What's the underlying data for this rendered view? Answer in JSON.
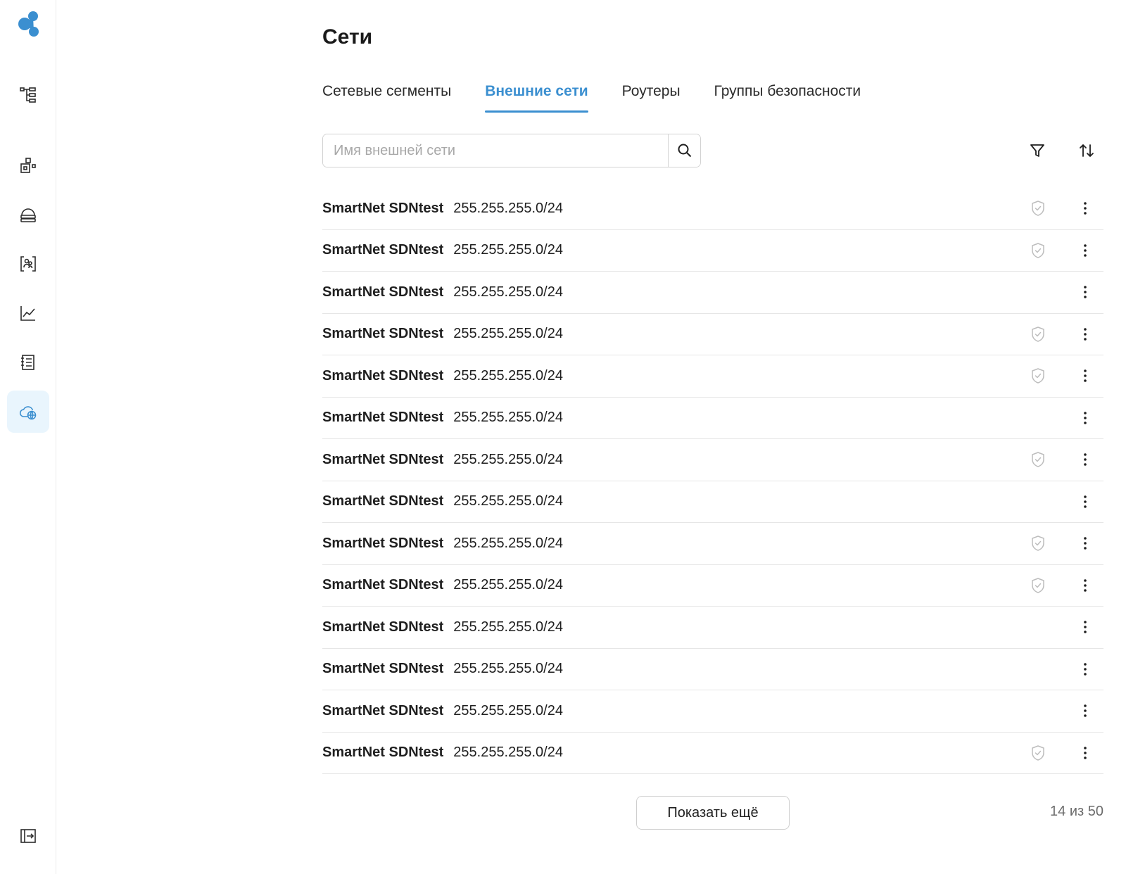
{
  "sidebar": {
    "logo_icon": "cluster-logo-icon",
    "items": [
      {
        "icon": "hierarchy-tree-icon",
        "active": false
      },
      {
        "icon": "components-icon",
        "active": false
      },
      {
        "icon": "storage-icon",
        "active": false
      },
      {
        "icon": "users-frame-icon",
        "active": false
      },
      {
        "icon": "chart-line-icon",
        "active": false
      },
      {
        "icon": "list-document-icon",
        "active": false
      },
      {
        "icon": "cloud-network-icon",
        "active": true
      }
    ],
    "collapse_icon": "collapse-sidebar-icon"
  },
  "page": {
    "title": "Сети"
  },
  "tabs": [
    {
      "label": "Сетевые сегменты",
      "active": false
    },
    {
      "label": "Внешние сети",
      "active": true
    },
    {
      "label": "Роутеры",
      "active": false
    },
    {
      "label": "Группы безопасности",
      "active": false
    }
  ],
  "search": {
    "placeholder": "Имя внешней сети",
    "value": ""
  },
  "toolbar": {
    "filter_icon": "filter-icon",
    "sort_icon": "sort-icon"
  },
  "networks": [
    {
      "name": "SmartNet SDNtest",
      "cidr": "255.255.255.0/24",
      "shield": true
    },
    {
      "name": "SmartNet SDNtest",
      "cidr": "255.255.255.0/24",
      "shield": true
    },
    {
      "name": "SmartNet SDNtest",
      "cidr": "255.255.255.0/24",
      "shield": false
    },
    {
      "name": "SmartNet SDNtest",
      "cidr": "255.255.255.0/24",
      "shield": true
    },
    {
      "name": "SmartNet SDNtest",
      "cidr": "255.255.255.0/24",
      "shield": true
    },
    {
      "name": "SmartNet SDNtest",
      "cidr": "255.255.255.0/24",
      "shield": false
    },
    {
      "name": "SmartNet SDNtest",
      "cidr": "255.255.255.0/24",
      "shield": true
    },
    {
      "name": "SmartNet SDNtest",
      "cidr": "255.255.255.0/24",
      "shield": false
    },
    {
      "name": "SmartNet SDNtest",
      "cidr": "255.255.255.0/24",
      "shield": true
    },
    {
      "name": "SmartNet SDNtest",
      "cidr": "255.255.255.0/24",
      "shield": true
    },
    {
      "name": "SmartNet SDNtest",
      "cidr": "255.255.255.0/24",
      "shield": false
    },
    {
      "name": "SmartNet SDNtest",
      "cidr": "255.255.255.0/24",
      "shield": false
    },
    {
      "name": "SmartNet SDNtest",
      "cidr": "255.255.255.0/24",
      "shield": false
    },
    {
      "name": "SmartNet SDNtest",
      "cidr": "255.255.255.0/24",
      "shield": true
    }
  ],
  "pagination": {
    "more_label": "Показать ещё",
    "counter": "14 из 50"
  },
  "colors": {
    "accent": "#3b8fd0",
    "active_bg": "#e9f5fd",
    "divider": "#e6e6e6"
  }
}
